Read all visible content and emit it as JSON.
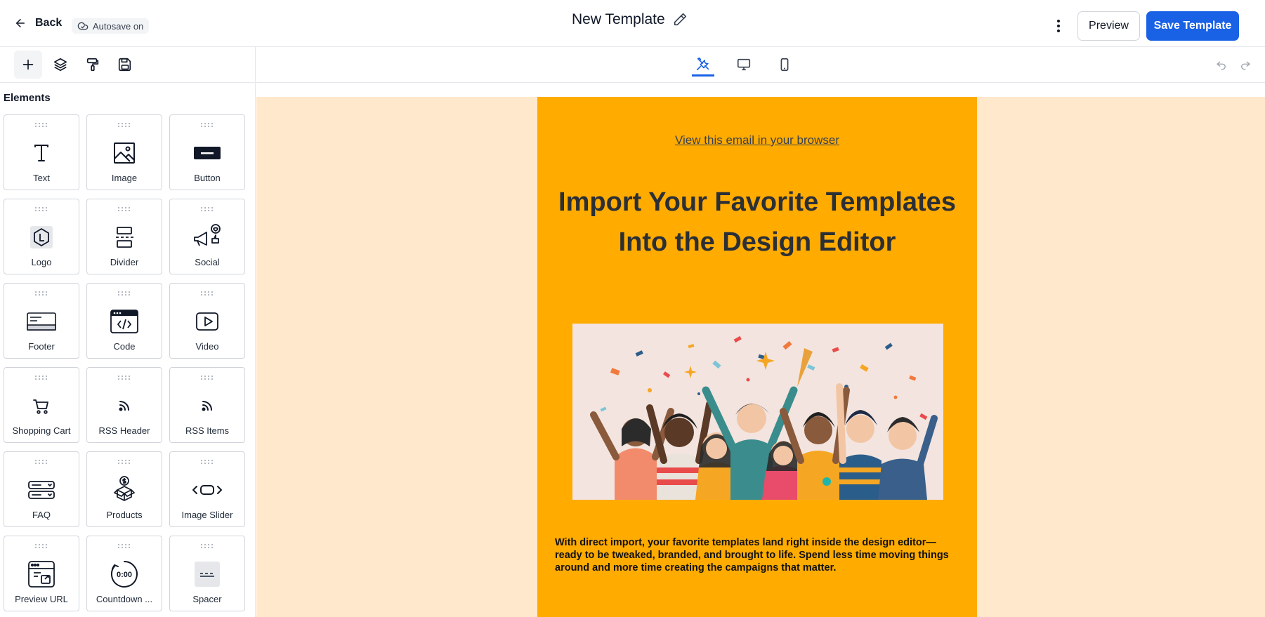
{
  "header": {
    "back_label": "Back",
    "autosave_label": "Autosave on",
    "title": "New Template",
    "preview_label": "Preview",
    "save_label": "Save Template"
  },
  "sidebar": {
    "tools": [
      {
        "name": "add",
        "icon": "plus-icon",
        "active": true
      },
      {
        "name": "layers",
        "icon": "layers-icon",
        "active": false
      },
      {
        "name": "styles",
        "icon": "paint-roller-icon",
        "active": false
      },
      {
        "name": "saved",
        "icon": "save-icon",
        "active": false
      }
    ],
    "heading": "Elements",
    "elements": [
      {
        "label": "Text",
        "icon": "text-icon"
      },
      {
        "label": "Image",
        "icon": "image-icon"
      },
      {
        "label": "Button",
        "icon": "button-icon"
      },
      {
        "label": "Logo",
        "icon": "logo-icon"
      },
      {
        "label": "Divider",
        "icon": "divider-icon"
      },
      {
        "label": "Social",
        "icon": "social-icon"
      },
      {
        "label": "Footer",
        "icon": "footer-icon"
      },
      {
        "label": "Code",
        "icon": "code-icon"
      },
      {
        "label": "Video",
        "icon": "video-icon"
      },
      {
        "label": "Shopping Cart",
        "icon": "shopping-cart-icon"
      },
      {
        "label": "RSS Header",
        "icon": "rss-icon"
      },
      {
        "label": "RSS Items",
        "icon": "rss-icon"
      },
      {
        "label": "FAQ",
        "icon": "faq-icon"
      },
      {
        "label": "Products",
        "icon": "products-icon"
      },
      {
        "label": "Image Slider",
        "icon": "image-slider-icon"
      },
      {
        "label": "Preview URL",
        "icon": "preview-url-icon"
      },
      {
        "label": "Countdown ...",
        "icon": "countdown-icon"
      },
      {
        "label": "Spacer",
        "icon": "spacer-icon"
      }
    ]
  },
  "canvas": {
    "view_tabs": [
      {
        "name": "editor",
        "icon": "tools-icon",
        "active": true
      },
      {
        "name": "desktop",
        "icon": "desktop-icon",
        "active": false
      },
      {
        "name": "mobile",
        "icon": "mobile-icon",
        "active": false
      }
    ],
    "background_color": "#ffe8cc"
  },
  "email": {
    "background_color": "#ffab00",
    "view_in_browser": "View this email in your browser",
    "heading": "Import Your Favorite Templates Into the Design Editor",
    "image_description_icon": "celebration-illustration",
    "body": "With direct import, your favorite templates land right inside the design editor—ready to be tweaked, branded, and brought to life. Spend less time moving things around and more time creating the campaigns that matter."
  },
  "colors": {
    "accent": "#1a62e5",
    "border": "#d1d5db"
  }
}
